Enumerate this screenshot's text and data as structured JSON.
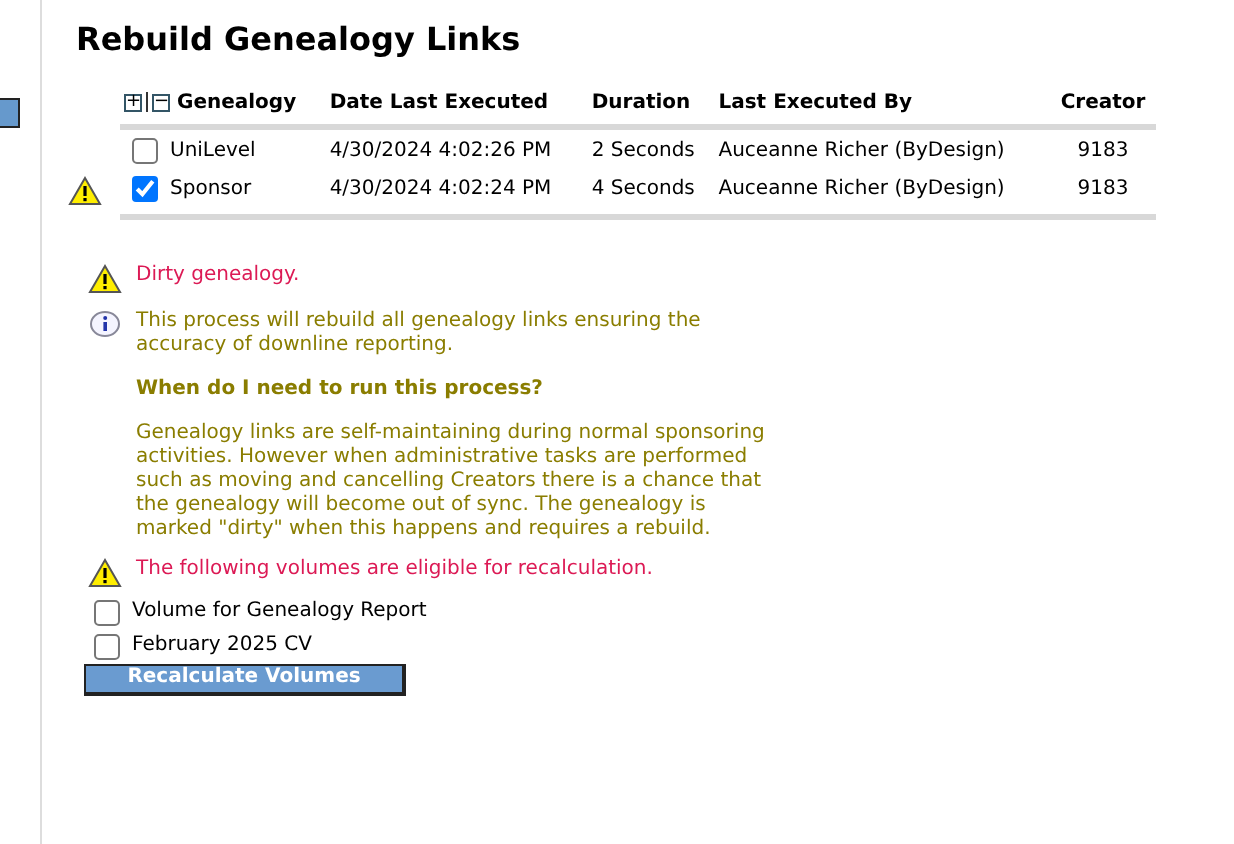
{
  "title": "Rebuild Genealogy Links",
  "table": {
    "expand_controls": [
      "+",
      "−"
    ],
    "columns": [
      "Genealogy",
      "Date Last Executed",
      "Duration",
      "Last Executed By",
      "Creator"
    ],
    "rows": [
      {
        "dirty": false,
        "checked": false,
        "cells": [
          "UniLevel",
          "4/30/2024 4:02:26 PM",
          "2 Seconds",
          "Auceanne Richer (ByDesign)",
          "9183"
        ]
      },
      {
        "dirty": true,
        "checked": true,
        "cells": [
          "Sponsor",
          "4/30/2024 4:02:24 PM",
          "4 Seconds",
          "Auceanne Richer (ByDesign)",
          "9183"
        ]
      }
    ]
  },
  "messages": [
    {
      "kind": "warning",
      "text": "Dirty genealogy."
    },
    {
      "kind": "info",
      "text": "This process will rebuild all genealogy links ensuring the accuracy of downline reporting.",
      "heading": "When do I need to run this process?",
      "detail": "Genealogy links are self-maintaining during normal sponsoring activities. However when administrative tasks are performed such as moving and cancelling Creators there is a chance that the genealogy will become out of sync. The genealogy is marked \"dirty\" when this happens and requires a rebuild."
    },
    {
      "kind": "warning",
      "text": "The following volumes are eligible for recalculation."
    }
  ],
  "volumes": [
    {
      "label": "Volume for Genealogy Report",
      "checked": false
    },
    {
      "label": "February 2025 CV",
      "checked": false
    }
  ],
  "button": "Recalculate Volumes"
}
